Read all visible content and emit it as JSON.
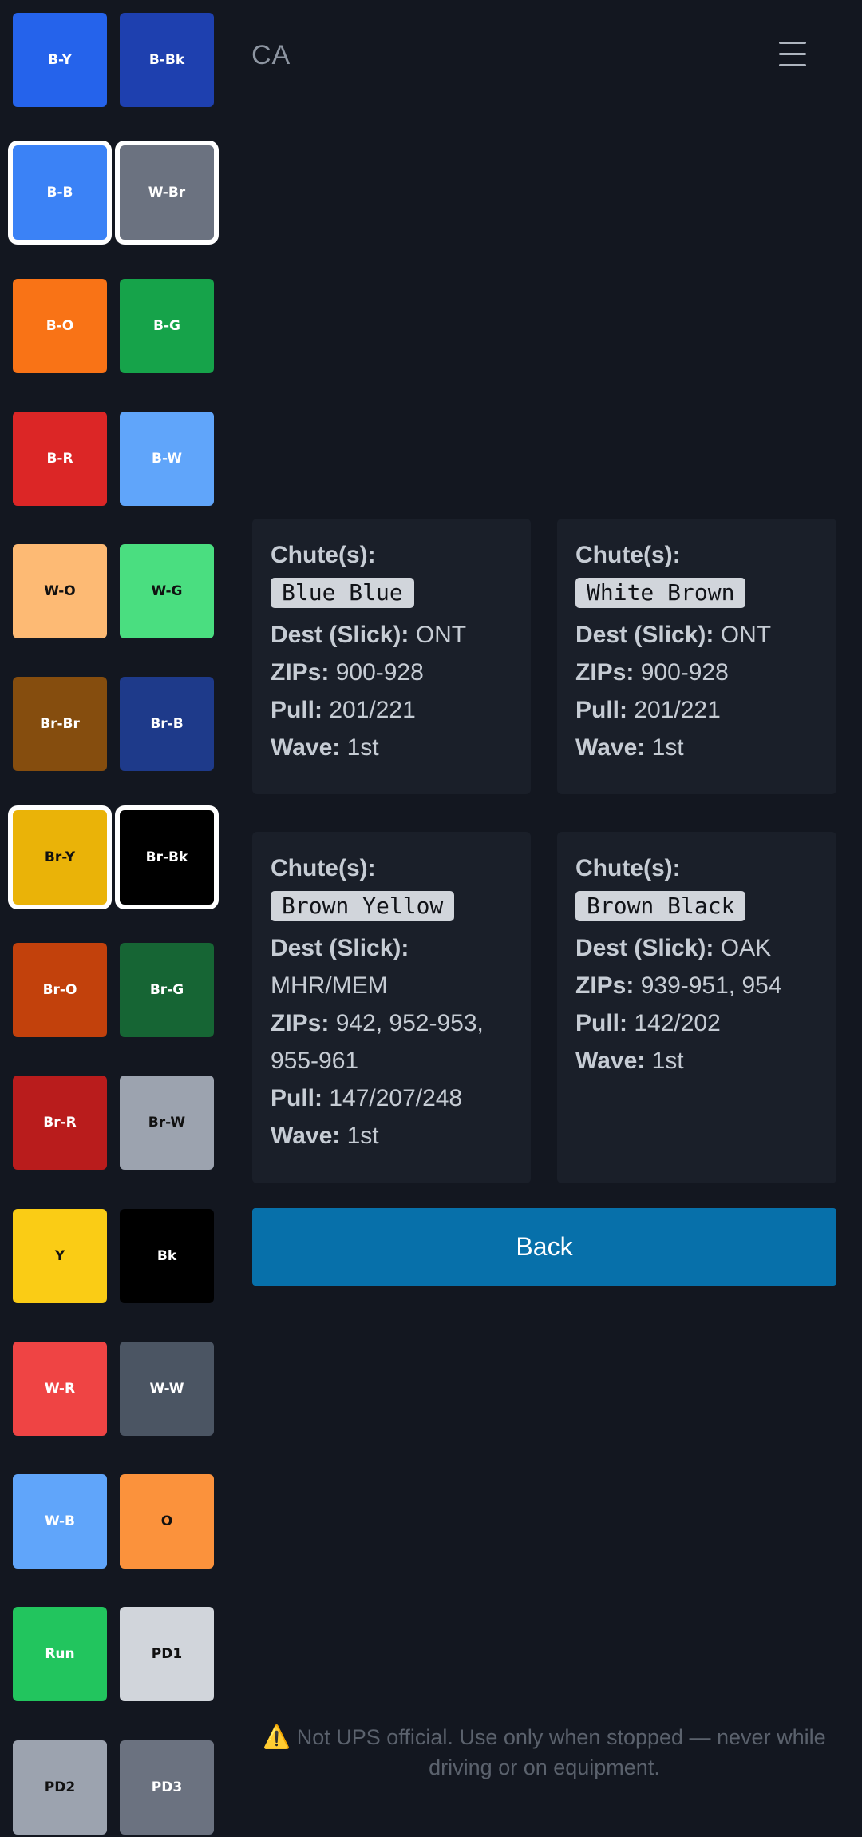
{
  "header": {
    "title": "CA"
  },
  "menu": {
    "icon": "hamburger-menu-icon"
  },
  "tiles": [
    {
      "label": "B-Y",
      "bg": "#2563eb",
      "fg": "#ffffff",
      "selected": false
    },
    {
      "label": "B-Bk",
      "bg": "#1e40af",
      "fg": "#ffffff",
      "selected": false
    },
    {
      "label": "B-B",
      "bg": "#3b82f6",
      "fg": "#ffffff",
      "selected": true
    },
    {
      "label": "W-Br",
      "bg": "#6b7280",
      "fg": "#ffffff",
      "selected": true
    },
    {
      "label": "B-O",
      "bg": "#f97316",
      "fg": "#ffffff",
      "selected": false
    },
    {
      "label": "B-G",
      "bg": "#16a34a",
      "fg": "#ffffff",
      "selected": false
    },
    {
      "label": "B-R",
      "bg": "#dc2626",
      "fg": "#ffffff",
      "selected": false
    },
    {
      "label": "B-W",
      "bg": "#60a5fa",
      "fg": "#ffffff",
      "selected": false
    },
    {
      "label": "W-O",
      "bg": "#fdba74",
      "fg": "#111111",
      "selected": false
    },
    {
      "label": "W-G",
      "bg": "#4ade80",
      "fg": "#111111",
      "selected": false
    },
    {
      "label": "Br-Br",
      "bg": "#854d0e",
      "fg": "#ffffff",
      "selected": false
    },
    {
      "label": "Br-B",
      "bg": "#1e3a8a",
      "fg": "#ffffff",
      "selected": false
    },
    {
      "label": "Br-Y",
      "bg": "#eab308",
      "fg": "#111111",
      "selected": true
    },
    {
      "label": "Br-Bk",
      "bg": "#000000",
      "fg": "#ffffff",
      "selected": true
    },
    {
      "label": "Br-O",
      "bg": "#c2410c",
      "fg": "#ffffff",
      "selected": false
    },
    {
      "label": "Br-G",
      "bg": "#166534",
      "fg": "#ffffff",
      "selected": false
    },
    {
      "label": "Br-R",
      "bg": "#b91c1c",
      "fg": "#ffffff",
      "selected": false
    },
    {
      "label": "Br-W",
      "bg": "#9ca3af",
      "fg": "#111111",
      "selected": false
    },
    {
      "label": "Y",
      "bg": "#facc15",
      "fg": "#111111",
      "selected": false
    },
    {
      "label": "Bk",
      "bg": "#000000",
      "fg": "#ffffff",
      "selected": false
    },
    {
      "label": "W-R",
      "bg": "#ef4444",
      "fg": "#ffffff",
      "selected": false
    },
    {
      "label": "W-W",
      "bg": "#4b5563",
      "fg": "#ffffff",
      "selected": false
    },
    {
      "label": "W-B",
      "bg": "#60a5fa",
      "fg": "#ffffff",
      "selected": false
    },
    {
      "label": "O",
      "bg": "#fb923c",
      "fg": "#111111",
      "selected": false
    },
    {
      "label": "Run",
      "bg": "#22c55e",
      "fg": "#ffffff",
      "selected": false
    },
    {
      "label": "PD1",
      "bg": "#d1d5db",
      "fg": "#111111",
      "selected": false
    },
    {
      "label": "PD2",
      "bg": "#9ca3af",
      "fg": "#111111",
      "selected": false
    },
    {
      "label": "PD3",
      "bg": "#6b7280",
      "fg": "#ffffff",
      "selected": false
    }
  ],
  "cards": [
    {
      "chute_label": "Chute(s):",
      "chute_name": "Blue Blue",
      "dest_label": "Dest (Slick):",
      "dest": "ONT",
      "zips_label": "ZIPs:",
      "zips": "900-928",
      "pull_label": "Pull:",
      "pull": "201/221",
      "wave_label": "Wave:",
      "wave": "1st"
    },
    {
      "chute_label": "Chute(s):",
      "chute_name": "White Brown",
      "dest_label": "Dest (Slick):",
      "dest": "ONT",
      "zips_label": "ZIPs:",
      "zips": "900-928",
      "pull_label": "Pull:",
      "pull": "201/221",
      "wave_label": "Wave:",
      "wave": "1st"
    },
    {
      "chute_label": "Chute(s):",
      "chute_name": "Brown Yellow",
      "dest_label": "Dest (Slick):",
      "dest": "MHR/MEM",
      "zips_label": "ZIPs:",
      "zips": "942, 952-953, 955-961",
      "pull_label": "Pull:",
      "pull": "147/207/248",
      "wave_label": "Wave:",
      "wave": "1st"
    },
    {
      "chute_label": "Chute(s):",
      "chute_name": "Brown Black",
      "dest_label": "Dest (Slick):",
      "dest": "OAK",
      "zips_label": "ZIPs:",
      "zips": "939-951, 954",
      "pull_label": "Pull:",
      "pull": "142/202",
      "wave_label": "Wave:",
      "wave": "1st"
    }
  ],
  "back_button": {
    "label": "Back"
  },
  "disclaimer": {
    "icon": "warning-icon",
    "icon_glyph": "⚠️",
    "text": "Not UPS official. Use only when stopped — never while driving or on equipment."
  }
}
